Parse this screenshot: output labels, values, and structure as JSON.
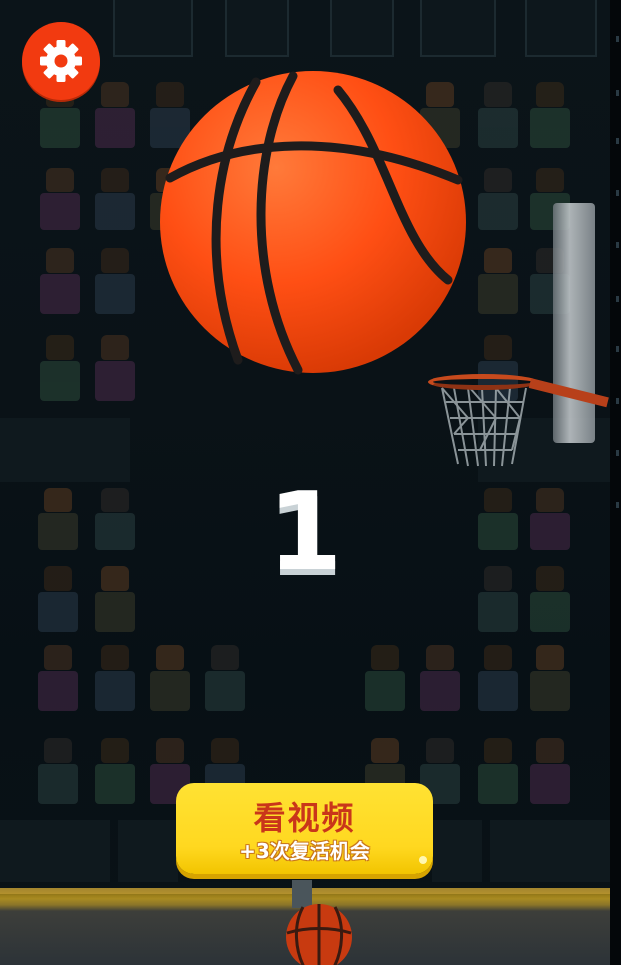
{
  "game": {
    "score": "1"
  },
  "revive_button": {
    "title": "看视频",
    "subtitle": "+3次复活机会"
  },
  "icons": {
    "settings": "gear-icon",
    "ball": "basketball"
  },
  "colors": {
    "settings_bg": "#f23a10",
    "button_bg": "#ffd820",
    "button_title": "#c9361a",
    "ball": "#ff5a1c",
    "score": "#ffffff"
  }
}
